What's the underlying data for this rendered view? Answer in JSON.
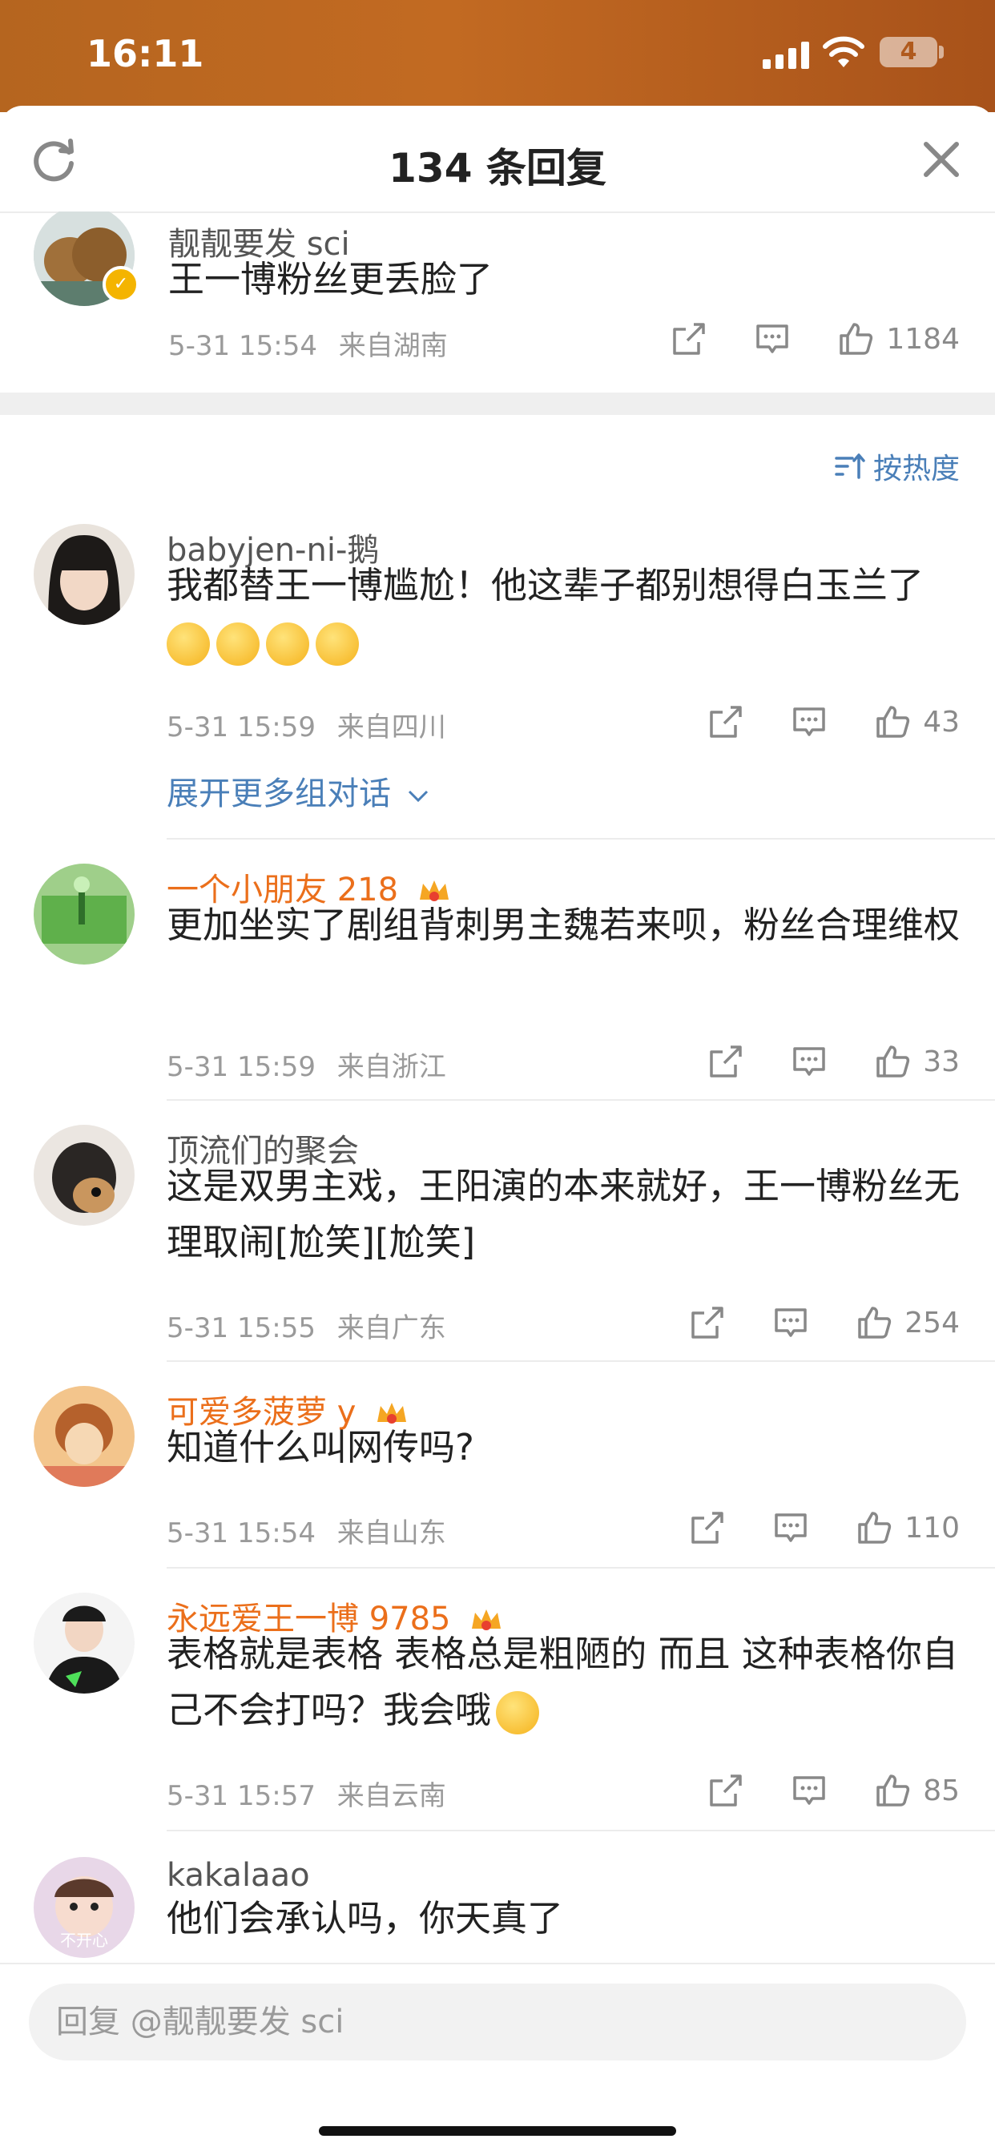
{
  "status_bar": {
    "time": "16:11",
    "battery": "4"
  },
  "header": {
    "title": "134 条回复"
  },
  "root_comment": {
    "username": "靓靓要发 sci",
    "text": "王一博粉丝更丢脸了",
    "time": "5-31 15:54",
    "location": "来自湖南",
    "likes": "1184"
  },
  "sort": {
    "label": "按热度"
  },
  "replies": [
    {
      "username": "babyjen-ni-鹅",
      "vip": false,
      "text": "我都替王一博尴尬！他这辈子都别想得白玉兰了",
      "time": "5-31 15:59",
      "location": "来自四川",
      "likes": "43",
      "expand": "展开更多组对话"
    },
    {
      "username": "一个小朋友 218",
      "vip": true,
      "text": "更加坐实了剧组背刺男主魏若来呗，粉丝合理维权",
      "time": "5-31 15:59",
      "location": "来自浙江",
      "likes": "33"
    },
    {
      "username": "顶流们的聚会",
      "vip": false,
      "text": "这是双男主戏，王阳演的本来就好，王一博粉丝无理取闹[尬笑][尬笑]",
      "time": "5-31 15:55",
      "location": "来自广东",
      "likes": "254"
    },
    {
      "username": "可爱多菠萝 y",
      "vip": true,
      "text": "知道什么叫网传吗?",
      "time": "5-31 15:54",
      "location": "来自山东",
      "likes": "110"
    },
    {
      "username": "永远爱王一博 9785",
      "vip": true,
      "text": "表格就是表格 表格总是粗陋的 而且 这种表格你自己不会打吗？我会哦",
      "time": "5-31 15:57",
      "location": "来自云南",
      "likes": "85"
    },
    {
      "username": "kakalaao",
      "vip": false,
      "text": "他们会承认吗，你天真了"
    }
  ],
  "avatar_labels": {
    "kakalaao": "不开心"
  },
  "reply_bar": {
    "placeholder": "回复 @靓靓要发 sci"
  },
  "colors": {
    "accent": "#4a7fb8",
    "vip_name": "#eb6f1b",
    "status_bg": "#b5651f"
  }
}
